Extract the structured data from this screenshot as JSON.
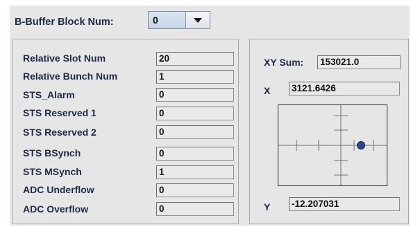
{
  "header": {
    "block_num_label": "B-Buffer Block Num:",
    "block_num_value": "0"
  },
  "status_fields": [
    {
      "label": "Relative Slot Num",
      "value": "20"
    },
    {
      "label": "Relative Bunch Num",
      "value": "1"
    },
    {
      "label": "STS_Alarm",
      "value": "0"
    },
    {
      "label": "STS Reserved 1",
      "value": "0"
    },
    {
      "label": "STS Reserved 2",
      "value": "0"
    },
    {
      "label": "STS BSynch",
      "value": "0"
    },
    {
      "label": "STS MSynch",
      "value": "1"
    },
    {
      "label": "ADC Underflow",
      "value": "0"
    },
    {
      "label": "ADC Overflow",
      "value": "0"
    }
  ],
  "position": {
    "xy_sum_label": "XY Sum:",
    "xy_sum_value": "153021.0",
    "x_label": "X",
    "x_value": "3121.6426",
    "y_label": "Y",
    "y_value": "-12.207031"
  },
  "colors": {
    "background": "#e6e6e6",
    "label_text": "#1d2a45",
    "marker": "#2a4a90"
  }
}
